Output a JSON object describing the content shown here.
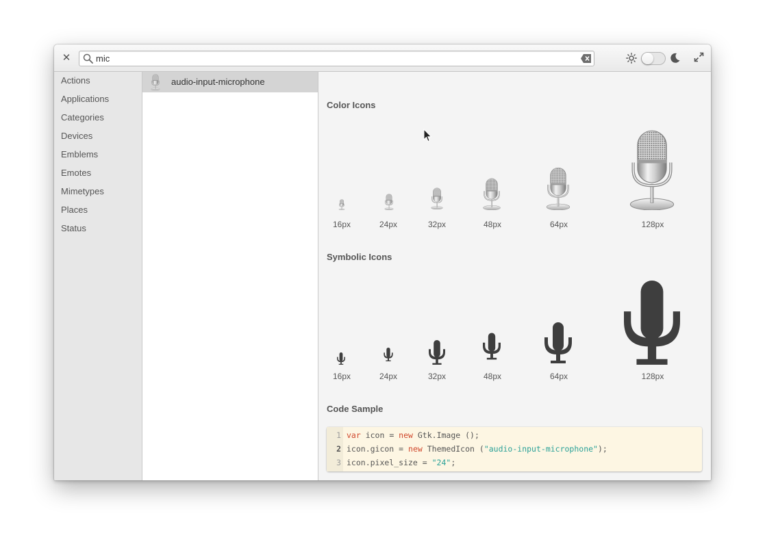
{
  "header": {
    "search": {
      "value": "mic",
      "placeholder": ""
    }
  },
  "sidebar": {
    "items": [
      {
        "label": "Actions"
      },
      {
        "label": "Applications"
      },
      {
        "label": "Categories"
      },
      {
        "label": "Devices"
      },
      {
        "label": "Emblems"
      },
      {
        "label": "Emotes"
      },
      {
        "label": "Mimetypes"
      },
      {
        "label": "Places"
      },
      {
        "label": "Status"
      }
    ]
  },
  "icon_list": {
    "items": [
      {
        "label": "audio-input-microphone",
        "icon": "microphone-icon"
      }
    ]
  },
  "detail": {
    "color_title": "Color Icons",
    "symbolic_title": "Symbolic Icons",
    "code_title": "Code Sample",
    "sizes": [
      "16px",
      "24px",
      "32px",
      "48px",
      "64px",
      "128px"
    ],
    "code": {
      "line_numbers": [
        "1",
        "2",
        "3"
      ],
      "line1": {
        "kw": "var",
        "rest": " icon = ",
        "kw2": "new",
        "tail": " Gtk.Image ();"
      },
      "line2": {
        "pre": "icon.gicon = ",
        "kw": "new",
        "mid": " ThemedIcon (",
        "str": "\"audio-input-microphone\"",
        "tail": ");"
      },
      "line3": {
        "pre": "icon.pixel_size = ",
        "str": "\"24\"",
        "tail": ";"
      }
    }
  },
  "colors": {
    "keyword": "#d0482d",
    "string": "#2aa198",
    "selected_row": "#d4d4d4",
    "code_bg": "#fdf6e3"
  }
}
